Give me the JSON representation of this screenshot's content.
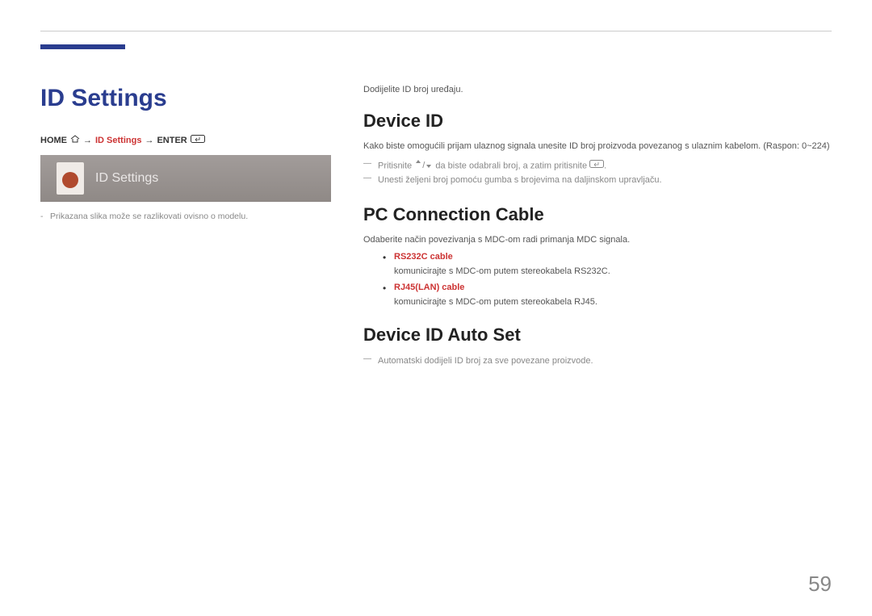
{
  "page": {
    "title": "ID Settings",
    "number": "59",
    "disclaimer": "Prikazana slika može se razlikovati ovisno o modelu."
  },
  "breadcrumb": {
    "home": "HOME",
    "arrow": "→",
    "mid": "ID Settings",
    "enter": "ENTER"
  },
  "preview": {
    "label": "ID Settings"
  },
  "intro": "Dodijelite ID broj uređaju.",
  "sections": {
    "deviceId": {
      "heading": "Device ID",
      "body": "Kako biste omogućili prijam ulaznog signala unesite ID broj proizvoda povezanog s ulaznim kabelom. (Raspon: 0~224)",
      "notes": {
        "n1a": "Pritisnite ",
        "n1b": " da biste odabrali broj, a zatim pritisnite ",
        "n1c": ".",
        "n2": "Unesti željeni broj pomoću gumba s brojevima na daljinskom upravljaču."
      }
    },
    "pcCable": {
      "heading": "PC Connection Cable",
      "body": "Odaberite način povezivanja s MDC-om radi primanja MDC signala.",
      "options": [
        {
          "name": "RS232C cable",
          "desc": "komunicirajte s MDC-om putem stereokabela RS232C."
        },
        {
          "name": "RJ45(LAN) cable",
          "desc": "komunicirajte s MDC-om putem stereokabela RJ45."
        }
      ]
    },
    "autoSet": {
      "heading": "Device ID Auto Set",
      "note": "Automatski dodijeli ID broj za sve povezane proizvode."
    }
  }
}
